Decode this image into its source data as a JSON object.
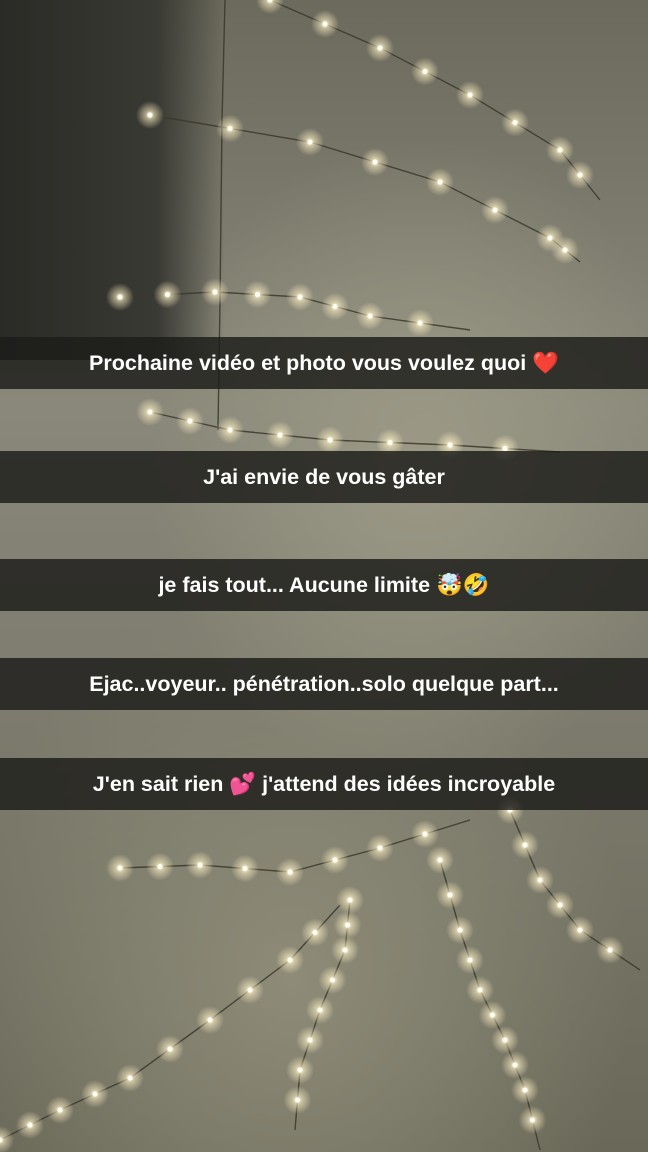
{
  "captions": [
    "Prochaine vidéo et photo vous voulez quoi ❤️",
    "J'ai envie de vous gâter",
    "je fais tout... Aucune limite 🤯🤣",
    "Ejac..voyeur.. pénétration..solo quelque part...",
    "J'en sait rien 💕 j'attend des idées incroyable"
  ],
  "background": {
    "scene": "string-lights-on-wall",
    "accent_colors": {
      "caption_bar": "#1c1c1a",
      "caption_text": "#ffffff",
      "light_glow": "#fff6d8"
    }
  }
}
